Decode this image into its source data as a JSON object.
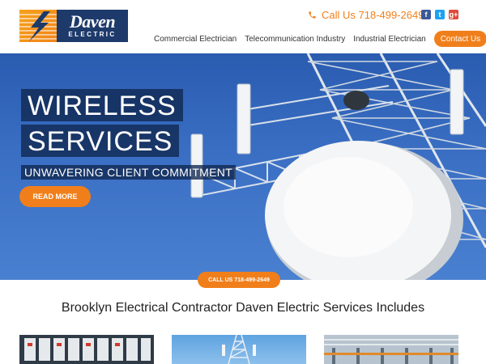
{
  "header": {
    "logo": {
      "name": "Daven",
      "sub": "ELECTRIC"
    },
    "phone": {
      "label": "Call Us 718-499-2649",
      "icon": "phone-icon"
    },
    "socials": [
      {
        "icon": "facebook-icon",
        "glyph": "f"
      },
      {
        "icon": "twitter-icon",
        "glyph": "t"
      },
      {
        "icon": "google-plus-icon",
        "glyph": "g+"
      }
    ],
    "nav": [
      {
        "label": "Commercial Electrician"
      },
      {
        "label": "Telecommunication Industry"
      },
      {
        "label": "Industrial Electrician"
      }
    ],
    "contact_label": "Contact Us"
  },
  "hero": {
    "title_line1": "WIRELESS",
    "title_line2": "SERVICES",
    "subtitle": "UNWAVERING CLIENT COMMITMENT",
    "cta": "READ MORE",
    "call_pill": "CALL US 718-499-2649"
  },
  "services": {
    "title": "Brooklyn Electrical Contractor Daven Electric Services Includes"
  },
  "colors": {
    "accent": "#f07f1b",
    "brand_navy": "#1d3a6b",
    "hero_blue": "#2a5cb0"
  }
}
